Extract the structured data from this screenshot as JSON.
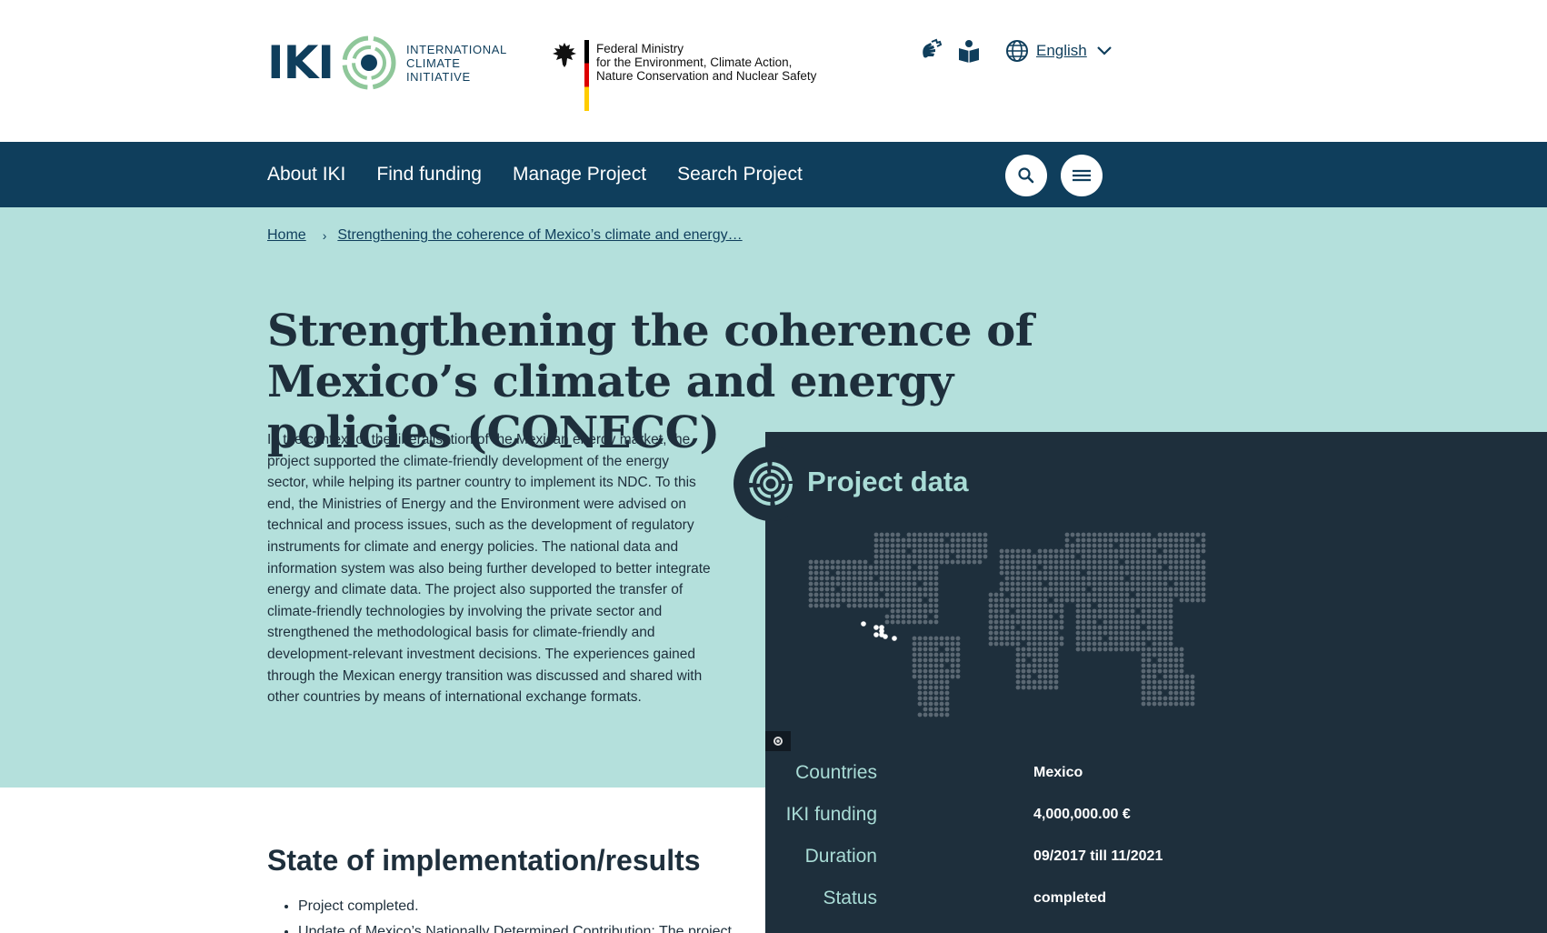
{
  "header": {
    "iki_wordmark": "IKI",
    "iki_subtitle": [
      "INTERNATIONAL",
      "CLIMATE",
      "INITIATIVE"
    ],
    "ministry_lines": [
      "Federal Ministry",
      "for the Environment, Climate Action,",
      "Nature Conservation and Nuclear Safety"
    ],
    "tools": [
      {
        "icon": "sign-language-icon"
      },
      {
        "icon": "easy-read-book-icon"
      }
    ],
    "language": {
      "icon": "globe-icon",
      "label": "English"
    }
  },
  "nav": {
    "items": [
      "About IKI",
      "Find funding",
      "Manage Project",
      "Search Project"
    ],
    "search_icon": "search-icon",
    "menu_icon": "hamburger-menu-icon"
  },
  "breadcrumb": {
    "home": "Home",
    "separator": "›",
    "current": "Strengthening the coherence of Mexico’s climate and energy…"
  },
  "page": {
    "title": "Strengthening the coherence of Mexico’s climate and energy policies (CONECC)",
    "intro": "In the context of the liberalisation of the Mexican energy market, the project supported the climate-friendly development of the energy sector, while helping its partner country to implement its NDC. To this end, the Ministries of Energy and the Environment were advised on technical and process issues, such as the development of regulatory instruments for climate and energy policies. The national data and information system was also being further developed to better integrate energy and climate data. The project also supported the transfer of climate-friendly technologies by involving the private sector and strengthened the methodological basis for climate-friendly and development-relevant investment decisions. The experiences gained through the Mexican energy transition was discussed and shared with other countries by means of international exchange formats."
  },
  "project_data": {
    "title": "Project data",
    "map_highlight": "Mexico",
    "image_credit_icon": "copyright-icon",
    "facts": [
      {
        "label": "Countries",
        "value": "Mexico"
      },
      {
        "label": "IKI funding",
        "value": "4,000,000.00 €"
      },
      {
        "label": "Duration",
        "value": "09/2017 till 11/2021"
      },
      {
        "label": "Status",
        "value": "completed"
      }
    ]
  },
  "results": {
    "title": "State of implementation/results",
    "items": [
      "Project completed.",
      "Update of Mexico’s Nationally Determined Contribution: The project"
    ]
  },
  "colors": {
    "navy": "#0f3e5c",
    "mint": "#b4e0dc",
    "panel": "#1e2f3c",
    "accent": "#a9dcd6",
    "logo_green": "#8fc79a"
  }
}
